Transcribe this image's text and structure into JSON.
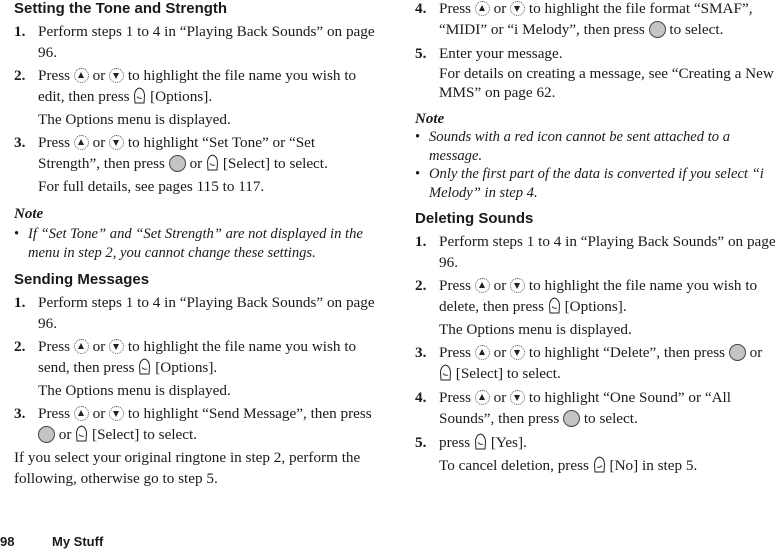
{
  "footer": {
    "page_number": "98",
    "section": "My Stuff"
  },
  "icons": {
    "up": "nav-up-icon",
    "down": "nav-down-icon",
    "center": "center-key-icon",
    "soft_right": "right-soft-key-icon",
    "soft_left": "left-soft-key-icon"
  },
  "tone": {
    "heading": "Setting the Tone and Strength",
    "s1": {
      "num": "1.",
      "text": "Perform steps 1 to 4 in “Playing Back Sounds” on page 96."
    },
    "s2": {
      "num": "2.",
      "a": "Press",
      "or": "or",
      "b": "to highlight the file name you wish to edit, then press",
      "c": "[Options].",
      "sub": "The Options menu is displayed."
    },
    "s3": {
      "num": "3.",
      "a": "Press",
      "or": "or",
      "b": "to highlight “Set Tone” or “Set Strength”, then press",
      "or2": "or",
      "c": "[Select] to select.",
      "sub": "For full details, see pages 115 to 117."
    },
    "note": {
      "title": "Note",
      "items": [
        "If “Set Tone” and “Set Strength” are not displayed in the menu in step 2, you cannot change these settings."
      ]
    }
  },
  "send": {
    "heading": "Sending Messages",
    "s1": {
      "num": "1.",
      "text": "Perform steps 1 to 4 in “Playing Back Sounds” on page 96."
    },
    "s2": {
      "num": "2.",
      "a": "Press",
      "or": "or",
      "b": "to highlight the file name you wish to send, then press",
      "c": "[Options].",
      "sub": "The Options menu is displayed."
    },
    "s3": {
      "num": "3.",
      "a": "Press",
      "or": "or",
      "b": "to highlight “Send Message”, then press",
      "or2": "or",
      "c": "[Select] to select."
    },
    "para": "If you select your original ringtone in step 2, perform the following, otherwise go to step 5.",
    "s4": {
      "num": "4.",
      "a": "Press",
      "or": "or",
      "b": "to highlight the file format “SMAF”, “MIDI” or “i Melody”, then press",
      "c": "to select."
    },
    "s5": {
      "num": "5.",
      "text": "Enter your message.",
      "sub": "For details on creating a message, see “Creating a New MMS” on page 62."
    },
    "note": {
      "title": "Note",
      "items": [
        "Sounds with a red icon cannot be sent attached to a message.",
        "Only the first part of the data is converted if you select “i Melody” in step 4."
      ]
    }
  },
  "del": {
    "heading": "Deleting Sounds",
    "s1": {
      "num": "1.",
      "text": "Perform steps 1 to 4 in “Playing Back Sounds” on page 96."
    },
    "s2": {
      "num": "2.",
      "a": "Press",
      "or": "or",
      "b": "to highlight the file name you wish to delete, then press",
      "c": "[Options].",
      "sub": "The Options menu is displayed."
    },
    "s3": {
      "num": "3.",
      "a": "Press",
      "or": "or",
      "b": "to highlight “Delete”, then press",
      "or2": "or",
      "c": "[Select] to select."
    },
    "s4": {
      "num": "4.",
      "a": "Press",
      "or": "or",
      "b": "to highlight “One Sound” or “All Sounds”, then press",
      "c": "to select."
    },
    "s5": {
      "num": "5.",
      "a": "press",
      "c": "[Yes].",
      "sub_a": "To cancel deletion, press",
      "sub_c": "[No] in step 5."
    }
  }
}
